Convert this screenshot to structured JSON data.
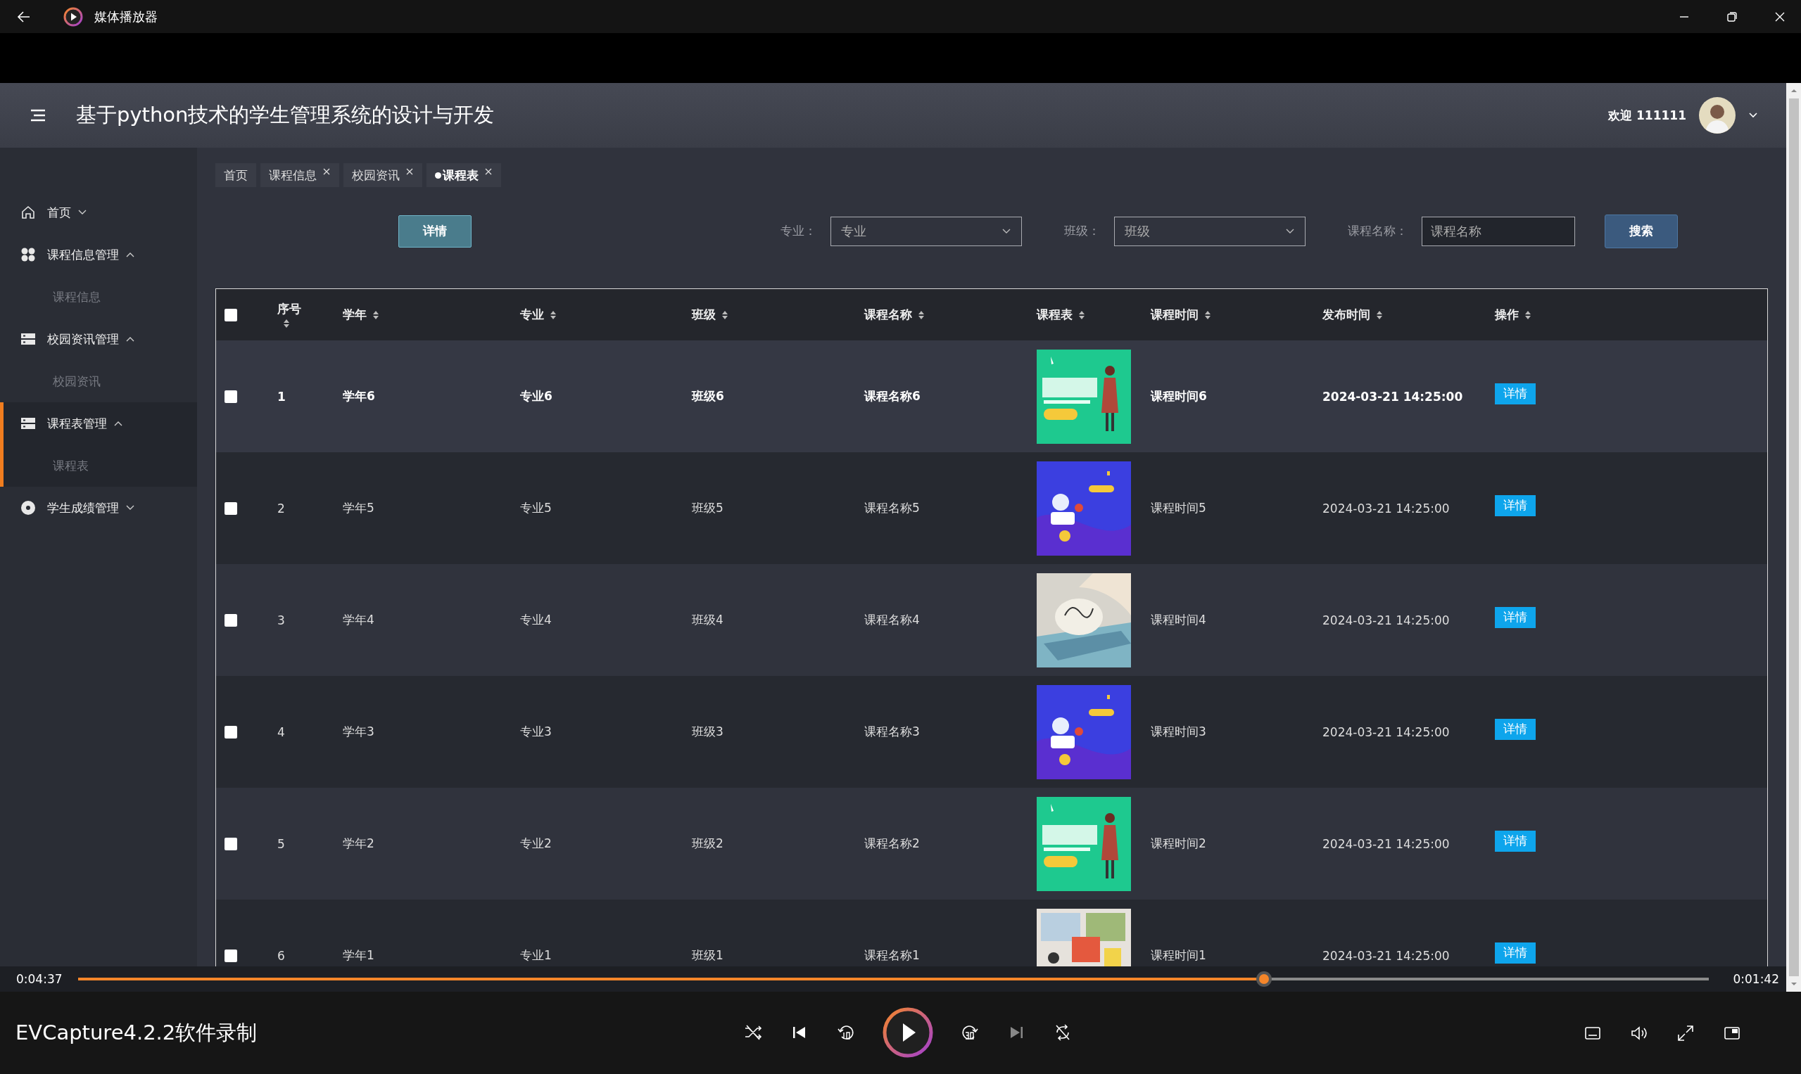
{
  "player": {
    "app_title": "媒体播放器",
    "video_title": "EVCapture4.2.2软件录制",
    "elapsed": "0:04:37",
    "remaining": "0:01:42",
    "progress": {
      "level": 0.727
    }
  },
  "app": {
    "title": "基于python技术的学生管理系统的设计与开发",
    "welcome": "欢迎 111111",
    "sidebar": {
      "items": [
        {
          "label": "首页",
          "expanded": false,
          "selected": false
        },
        {
          "label": "课程信息管理",
          "expanded": true,
          "selected": false,
          "children": [
            {
              "label": "课程信息"
            }
          ]
        },
        {
          "label": "校园资讯管理",
          "expanded": true,
          "selected": false,
          "children": [
            {
              "label": "校园资讯"
            }
          ]
        },
        {
          "label": "课程表管理",
          "expanded": true,
          "selected": true,
          "children": [
            {
              "label": "课程表"
            }
          ]
        },
        {
          "label": "学生成绩管理",
          "expanded": false,
          "selected": false
        }
      ]
    },
    "tabs": [
      {
        "label": "首页",
        "closable": false,
        "selected": false
      },
      {
        "label": "课程信息",
        "closable": true,
        "selected": false
      },
      {
        "label": "校园资讯",
        "closable": true,
        "selected": false
      },
      {
        "label": "课程表",
        "closable": true,
        "selected": true
      }
    ],
    "toolbar": {
      "detail_button": "详情",
      "filters": [
        {
          "kind": "select",
          "label": "专业：",
          "placeholder": "专业"
        },
        {
          "kind": "select",
          "label": "班级：",
          "placeholder": "班级"
        },
        {
          "kind": "input",
          "label": "课程名称：",
          "placeholder": "课程名称"
        }
      ],
      "search_button": "搜索"
    },
    "table": {
      "select_all": {
        "checked": false
      },
      "columns": [
        {
          "label": "序号",
          "kind": "text"
        },
        {
          "label": "学年",
          "kind": "text"
        },
        {
          "label": "专业",
          "kind": "text"
        },
        {
          "label": "班级",
          "kind": "text"
        },
        {
          "label": "课程名称",
          "kind": "text"
        },
        {
          "label": "课程表",
          "kind": "picture"
        },
        {
          "label": "课程时间",
          "kind": "text"
        },
        {
          "label": "发布时间",
          "kind": "text"
        },
        {
          "label": "操作",
          "kind": "button"
        }
      ],
      "rows": [
        {
          "checked": false,
          "highlighted": true,
          "cells": [
            "1",
            "学年6",
            "专业6",
            "班级6",
            "课程名称6",
            {
              "kind": "picture"
            },
            "课程时间6",
            "2024-03-21 14:25:00",
            "详情"
          ]
        },
        {
          "checked": false,
          "highlighted": false,
          "cells": [
            "2",
            "学年5",
            "专业5",
            "班级5",
            "课程名称5",
            {
              "kind": "picture"
            },
            "课程时间5",
            "2024-03-21 14:25:00",
            "详情"
          ]
        },
        {
          "checked": false,
          "highlighted": false,
          "cells": [
            "3",
            "学年4",
            "专业4",
            "班级4",
            "课程名称4",
            {
              "kind": "picture"
            },
            "课程时间4",
            "2024-03-21 14:25:00",
            "详情"
          ]
        },
        {
          "checked": false,
          "highlighted": false,
          "cells": [
            "4",
            "学年3",
            "专业3",
            "班级3",
            "课程名称3",
            {
              "kind": "picture"
            },
            "课程时间3",
            "2024-03-21 14:25:00",
            "详情"
          ]
        },
        {
          "checked": false,
          "highlighted": false,
          "cells": [
            "5",
            "学年2",
            "专业2",
            "班级2",
            "课程名称2",
            {
              "kind": "picture"
            },
            "课程时间2",
            "2024-03-21 14:25:00",
            "详情"
          ]
        },
        {
          "checked": false,
          "highlighted": false,
          "cells": [
            "6",
            "学年1",
            "专业1",
            "班级1",
            "课程名称1",
            {
              "kind": "picture"
            },
            "课程时间1",
            "2024-03-21 14:25:00",
            "详情"
          ]
        }
      ]
    }
  }
}
